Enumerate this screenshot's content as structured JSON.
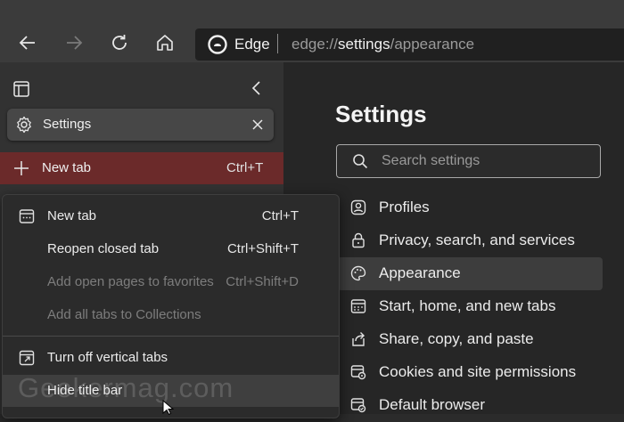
{
  "toolbar": {
    "back_icon": "back-arrow-icon",
    "forward_icon": "forward-arrow-icon",
    "refresh_icon": "refresh-icon",
    "home_icon": "home-icon",
    "address": {
      "brand": "Edge",
      "url_scheme": "edge://",
      "url_host": "settings",
      "url_path": "/appearance"
    }
  },
  "tab_pane": {
    "pane_icon": "tab-actions-icon",
    "collapse_icon": "chevron-left-icon",
    "tabs": [
      {
        "label": "Settings",
        "icon": "gear-icon",
        "close_icon": "close-icon"
      }
    ],
    "new_tab": {
      "label": "New tab",
      "shortcut": "Ctrl+T",
      "icon": "plus-icon"
    }
  },
  "context_menu": {
    "items": [
      {
        "label": "New tab",
        "shortcut": "Ctrl+T",
        "icon": "new-tab-icon",
        "enabled": true
      },
      {
        "label": "Reopen closed tab",
        "shortcut": "Ctrl+Shift+T",
        "icon": "",
        "enabled": true
      },
      {
        "label": "Add open pages to favorites",
        "shortcut": "Ctrl+Shift+D",
        "icon": "",
        "enabled": false
      },
      {
        "label": "Add all tabs to Collections",
        "shortcut": "",
        "icon": "",
        "enabled": false
      },
      {
        "label": "Turn off vertical tabs",
        "shortcut": "",
        "icon": "vertical-tabs-icon",
        "enabled": true
      },
      {
        "label": "Hide title bar",
        "shortcut": "",
        "icon": "",
        "enabled": true
      }
    ]
  },
  "watermark": "Geekermag.com",
  "settings": {
    "title": "Settings",
    "search_placeholder": "Search settings",
    "nav": [
      {
        "label": "Profiles",
        "icon": "profile-icon",
        "selected": false
      },
      {
        "label": "Privacy, search, and services",
        "icon": "lock-icon",
        "selected": false
      },
      {
        "label": "Appearance",
        "icon": "palette-icon",
        "selected": true
      },
      {
        "label": "Start, home, and new tabs",
        "icon": "start-home-icon",
        "selected": false
      },
      {
        "label": "Share, copy, and paste",
        "icon": "share-icon",
        "selected": false
      },
      {
        "label": "Cookies and site permissions",
        "icon": "cookies-icon",
        "selected": false
      },
      {
        "label": "Default browser",
        "icon": "browser-icon",
        "selected": false
      }
    ]
  },
  "colors": {
    "accent": "#4f9fe6",
    "new_tab_highlight": "#6b2a2a",
    "toolbar_bg": "#3b3b3b",
    "pane_bg": "#323232",
    "main_bg": "#262626"
  }
}
